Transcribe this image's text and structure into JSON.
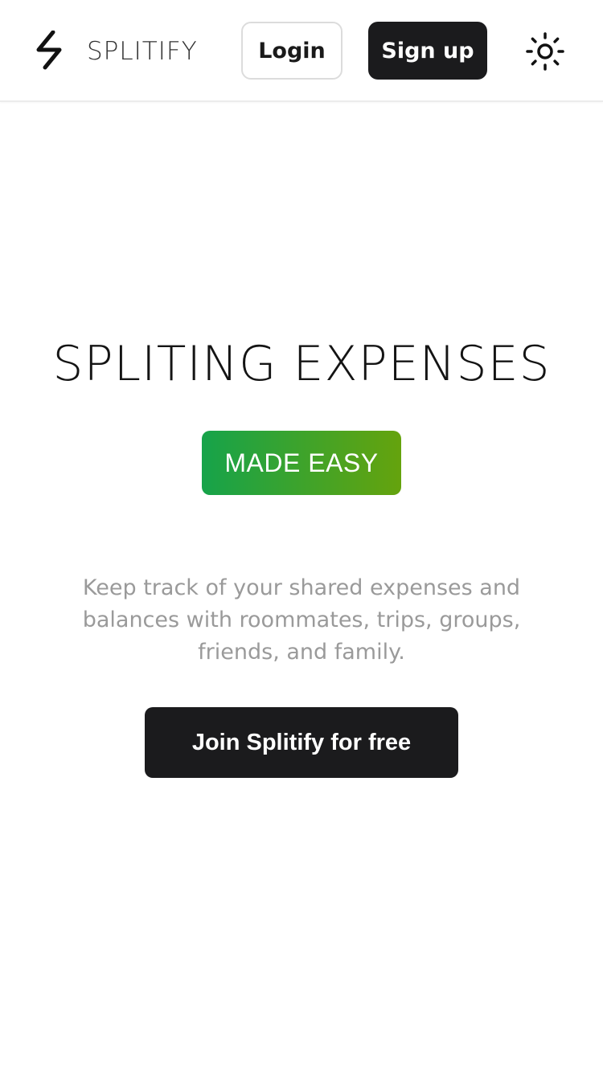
{
  "header": {
    "brand_name": "SPLITIFY",
    "logo_icon": "lightning-bolt-icon",
    "login_label": "Login",
    "signup_label": "Sign up",
    "theme_icon": "sun-icon"
  },
  "hero": {
    "title": "SPLITING EXPENSES",
    "badge": "MADE EASY",
    "description": "Keep track of your shared expenses and balances with roommates, trips, groups, friends, and family.",
    "cta_label": "Join Splitify for free"
  },
  "colors": {
    "primary_dark": "#1b1b1d",
    "badge_gradient_start": "#16a34a",
    "badge_gradient_end": "#65a30d",
    "muted_text": "#9a9a9a"
  }
}
